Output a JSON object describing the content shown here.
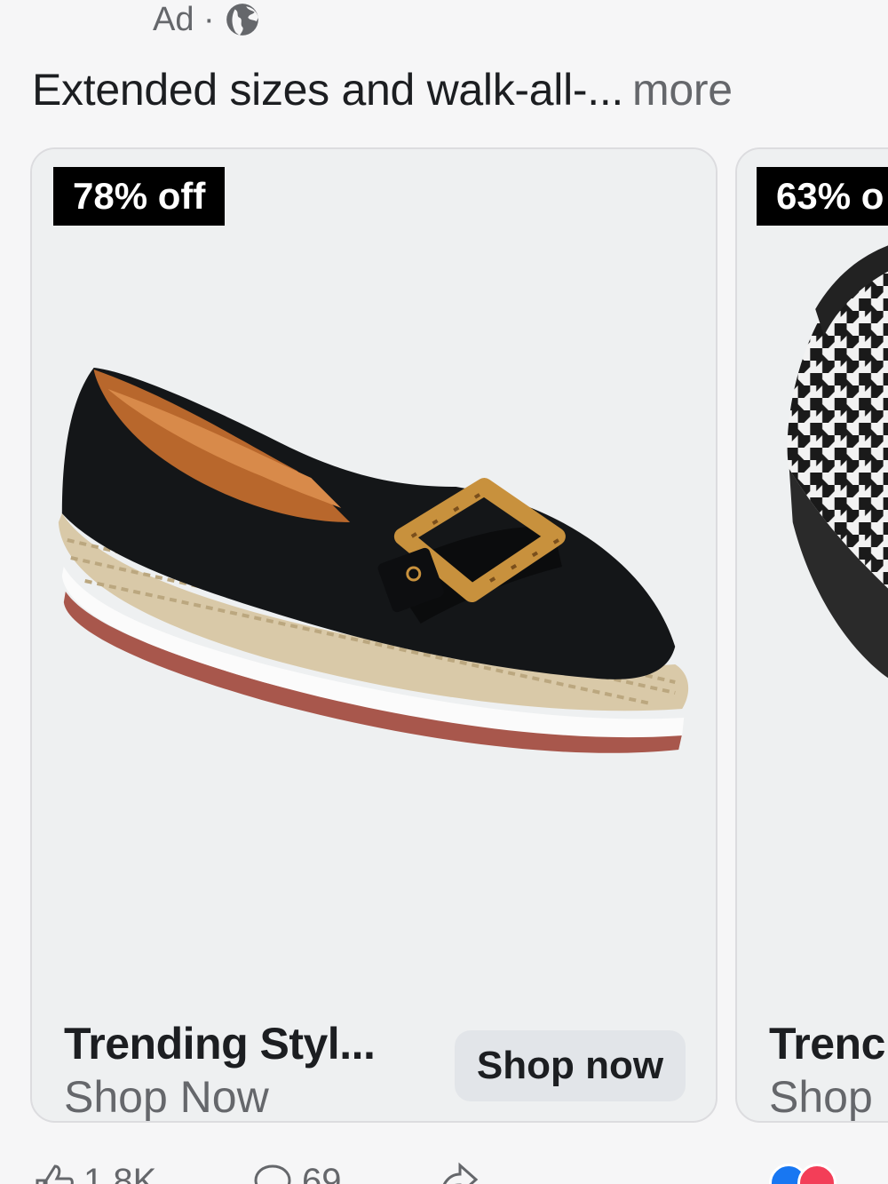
{
  "ad": {
    "label": "Ad ·",
    "icon": "globe-icon"
  },
  "caption": {
    "text": "Extended sizes and walk-all-...",
    "more": "more"
  },
  "cards": [
    {
      "badge": "78% off",
      "title": "Trending Styl...",
      "subtitle": "Shop Now",
      "button": "Shop now"
    },
    {
      "badge": "63% o",
      "title": "Trenc",
      "subtitle": "Shop"
    }
  ],
  "footer": {
    "likes": "1.8K",
    "comments": "69",
    "like_icon": "thumbs-up-icon",
    "comment_icon": "comment-icon",
    "share_icon": "share-icon"
  },
  "colors": {
    "background": "#f6f6f7",
    "card_bg": "#eef0f1",
    "secondary_text": "#65676b",
    "badge_bg": "#000000",
    "button_bg": "#e2e5e9"
  }
}
